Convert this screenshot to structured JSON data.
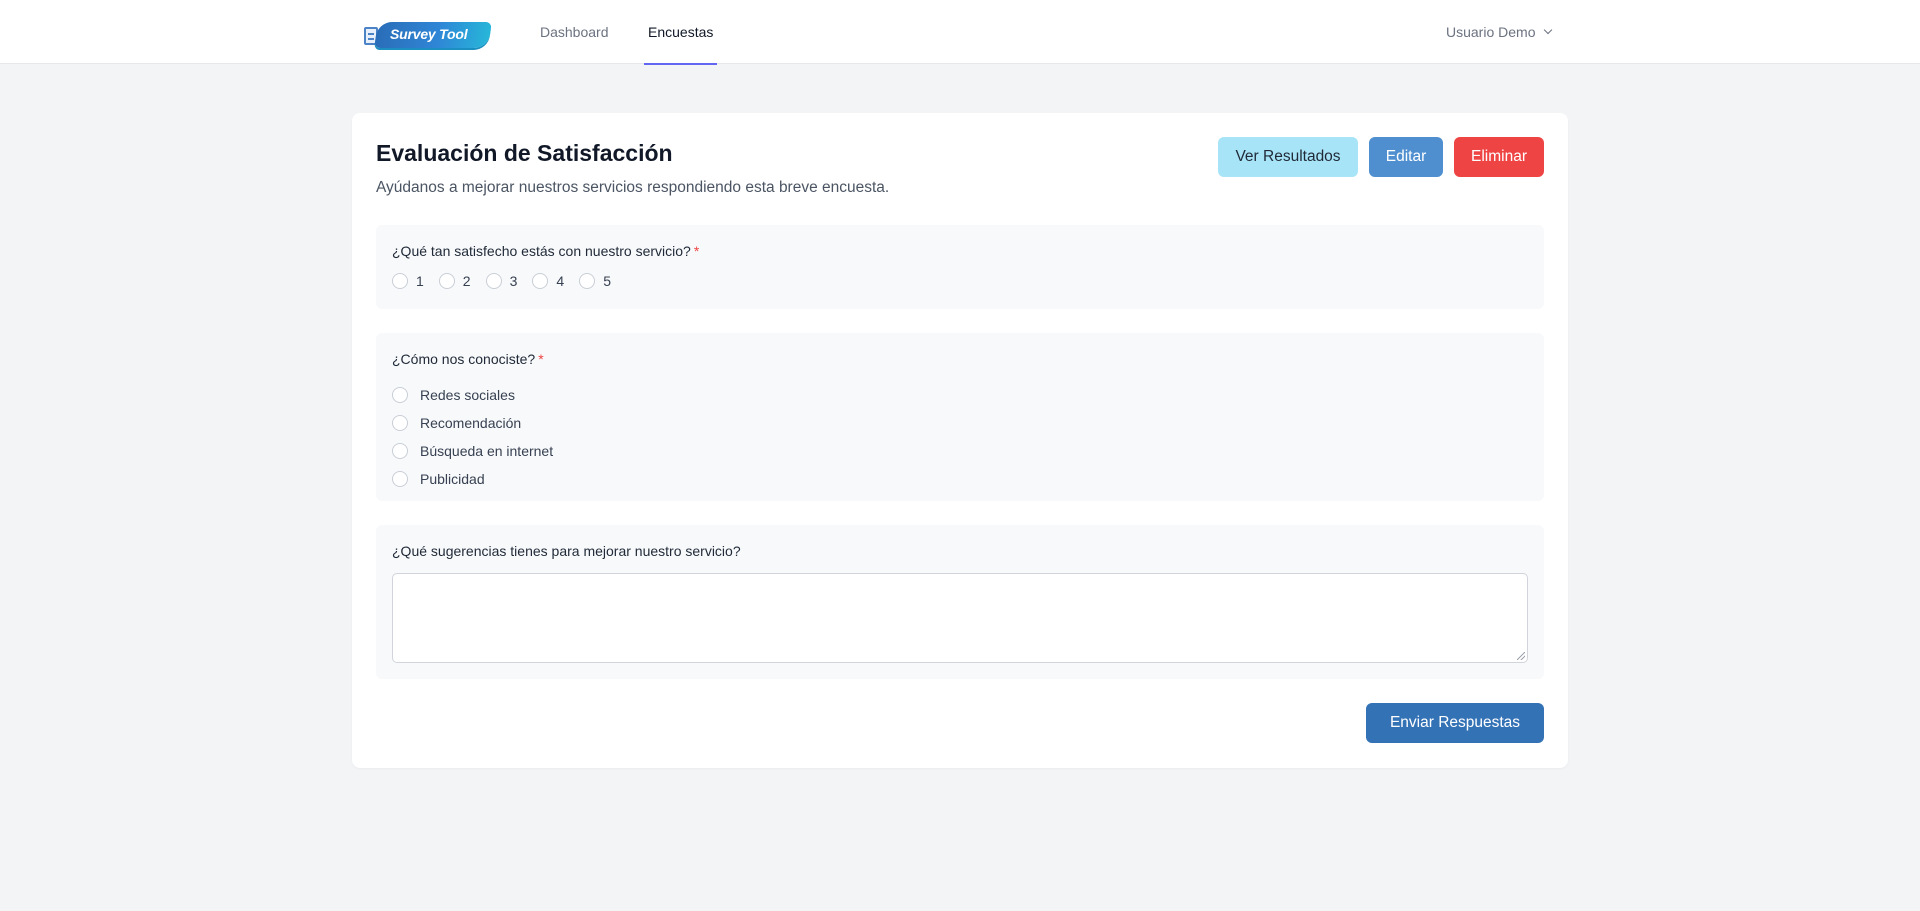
{
  "header": {
    "logo_text": "Survey Tool",
    "nav": [
      {
        "label": "Dashboard",
        "active": false
      },
      {
        "label": "Encuestas",
        "active": true
      }
    ],
    "user_label": "Usuario Demo"
  },
  "survey": {
    "title": "Evaluación de Satisfacción",
    "description": "Ayúdanos a mejorar nuestros servicios respondiendo esta breve encuesta.",
    "actions": {
      "results_label": "Ver Resultados",
      "edit_label": "Editar",
      "delete_label": "Eliminar"
    },
    "questions": [
      {
        "label": "¿Qué tan satisfecho estás con nuestro servicio?",
        "required_mark": "*",
        "options": [
          "1",
          "2",
          "3",
          "4",
          "5"
        ]
      },
      {
        "label": "¿Cómo nos conociste?",
        "required_mark": "*",
        "options": [
          "Redes sociales",
          "Recomendación",
          "Búsqueda en internet",
          "Publicidad"
        ]
      },
      {
        "label": "¿Qué sugerencias tienes para mejorar nuestro servicio?",
        "value": "",
        "placeholder": ""
      }
    ],
    "submit_label": "Enviar Respuestas"
  },
  "colors": {
    "accent": "#6366f1",
    "results_button": "#a8e4f7",
    "edit_button": "#4f8fd0",
    "delete_button": "#ef4444",
    "submit_button": "#3472b6",
    "required": "#ef4444"
  },
  "icons": {
    "logo": "document-icon",
    "user_menu": "chevron-down-icon"
  }
}
